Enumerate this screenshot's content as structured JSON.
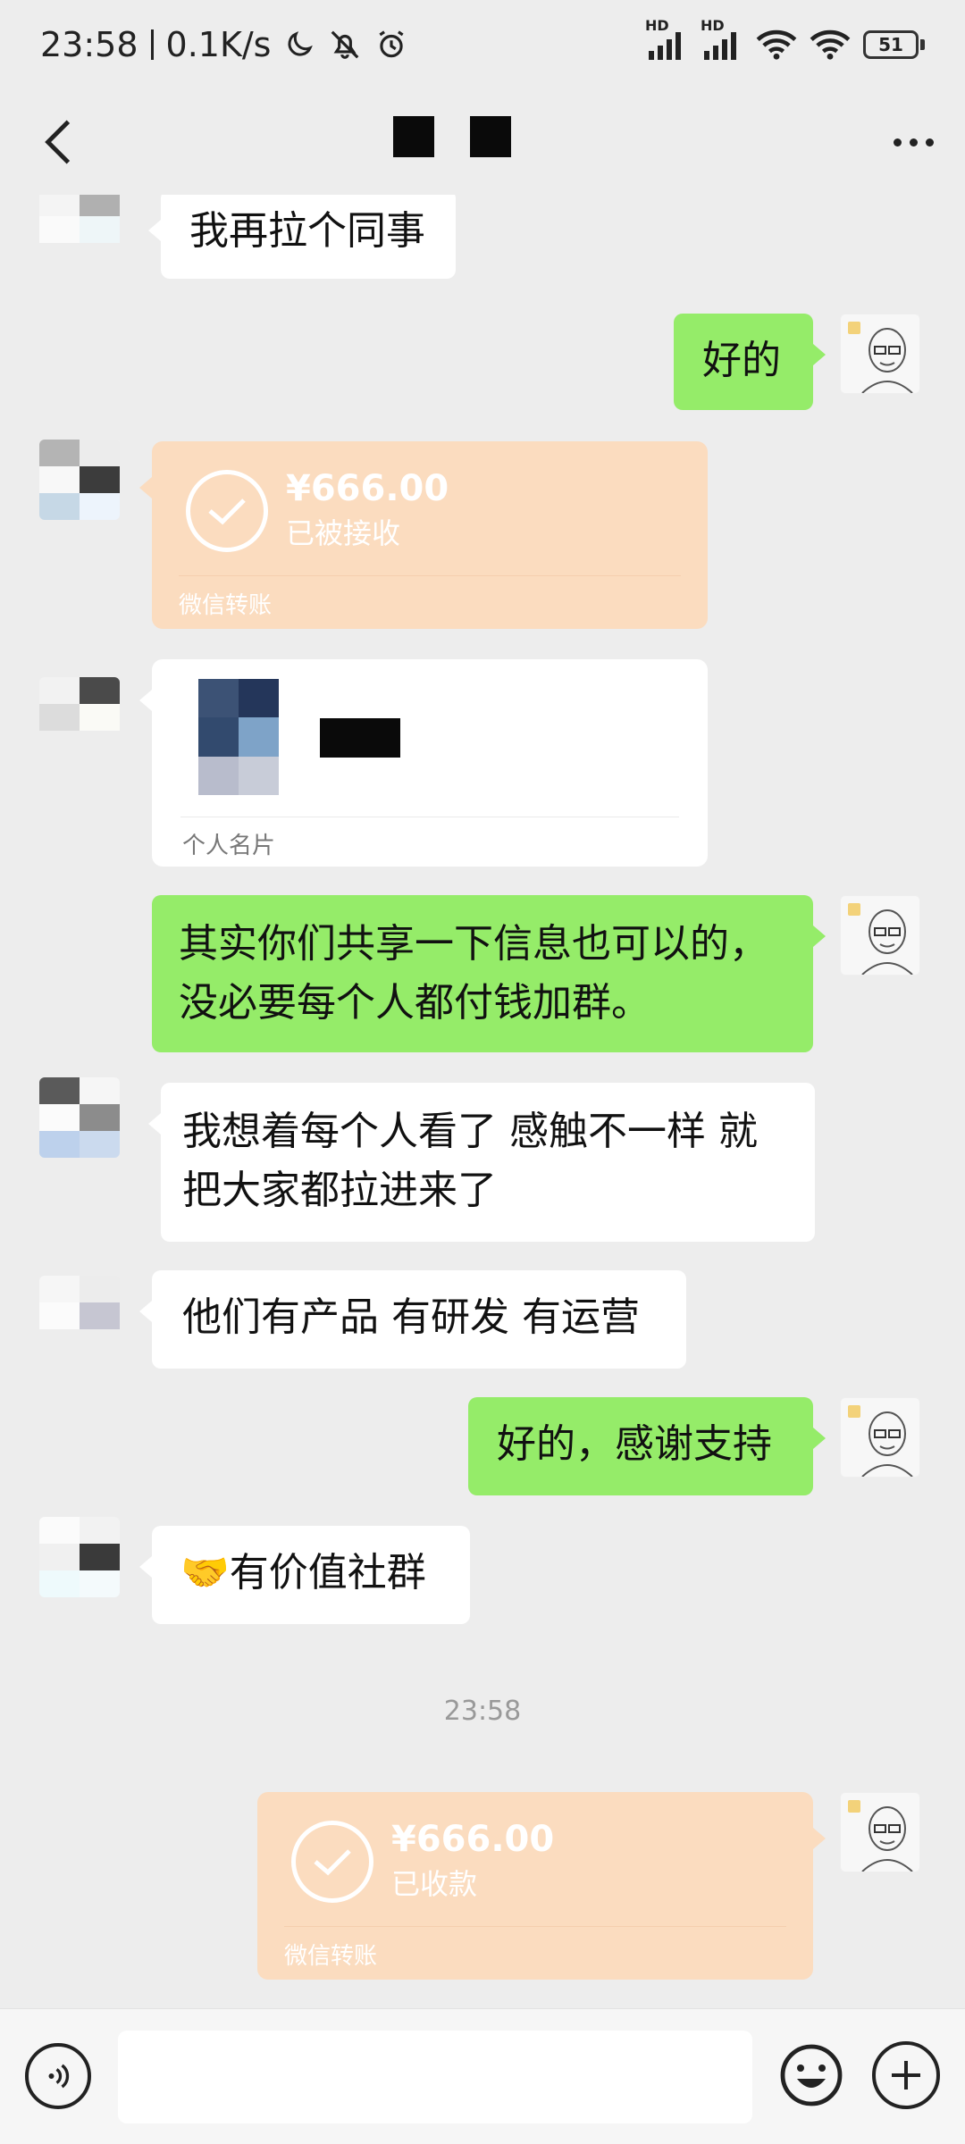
{
  "status_bar": {
    "time": "23:58",
    "speed": "0.1K/s",
    "signal1_label": "HD",
    "signal2_label": "HD",
    "battery": "51",
    "icons": [
      "moon-icon",
      "mute-icon",
      "alarm-icon",
      "signal-icon",
      "wifi-icon",
      "battery-icon"
    ]
  },
  "nav": {
    "back_icon": "chevron-left-icon",
    "more_icon": "more-dots-icon"
  },
  "messages": [
    {
      "side": "left",
      "type": "text",
      "text": "我再拉个同事"
    },
    {
      "side": "right",
      "type": "text",
      "text": "好的"
    },
    {
      "side": "left",
      "type": "transfer",
      "amount": "¥666.00",
      "status": "已被接收",
      "footer": "微信转账"
    },
    {
      "side": "left",
      "type": "contact_card",
      "label": "个人名片"
    },
    {
      "side": "right",
      "type": "text",
      "lines": [
        "其实你们共享一下信息也可以的，",
        "没必要每个人都付钱加群。"
      ]
    },
    {
      "side": "left",
      "type": "text",
      "lines": [
        "我想着每个人看了 感触不一样 就",
        "把大家都拉进来了"
      ]
    },
    {
      "side": "left",
      "type": "text",
      "text": "他们有产品 有研发 有运营"
    },
    {
      "side": "right",
      "type": "text",
      "text": "好的，感谢支持"
    },
    {
      "side": "left",
      "type": "text",
      "emoji": "🤝",
      "text": "有价值社群"
    },
    {
      "type": "time",
      "text": "23:58"
    },
    {
      "side": "right",
      "type": "transfer",
      "amount": "¥666.00",
      "status": "已收款",
      "footer": "微信转账"
    }
  ],
  "input_bar": {
    "voice_icon": "voice-icon",
    "emoji_icon": "emoji-icon",
    "plus_icon": "plus-icon",
    "placeholder": ""
  },
  "colors": {
    "background": "#ededed",
    "green_bubble": "#95ec69",
    "white_bubble": "#ffffff",
    "transfer_bubble": "#fbdcbf"
  }
}
